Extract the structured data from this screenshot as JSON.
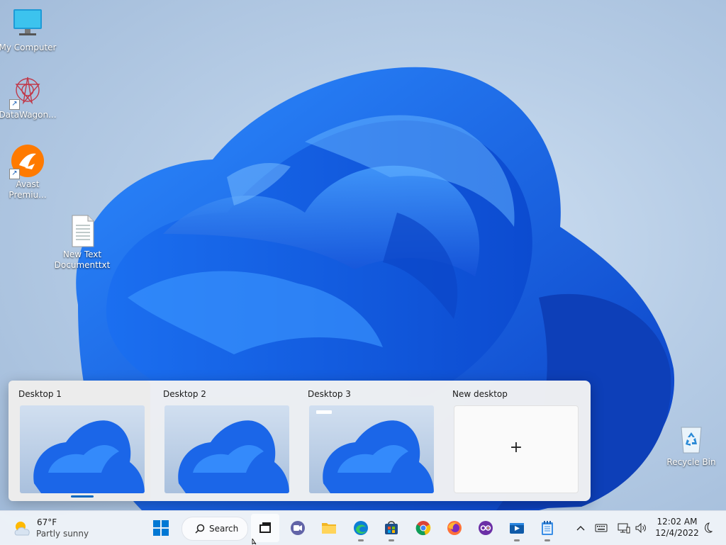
{
  "desktop": {
    "icons": [
      {
        "label": "My Computer",
        "icon": "monitor-icon"
      },
      {
        "label": "DataWagon...",
        "icon": "datawagon-icon"
      },
      {
        "label": "Avast Premiu...",
        "icon": "avast-icon"
      },
      {
        "label": "New Text Documenttxt",
        "icon": "text-file-icon"
      },
      {
        "label": "Recycle Bin",
        "icon": "recycle-bin-icon"
      }
    ]
  },
  "task_view": {
    "desktops": [
      {
        "label": "Desktop 1",
        "active": true
      },
      {
        "label": "Desktop 2",
        "active": false
      },
      {
        "label": "Desktop 3",
        "active": false
      }
    ],
    "new_desktop_label": "New desktop",
    "plus_symbol": "+"
  },
  "taskbar": {
    "weather": {
      "temp": "67°F",
      "condition": "Partly sunny"
    },
    "search_label": "Search",
    "apps": [
      {
        "name": "start",
        "icon": "windows-logo-icon"
      },
      {
        "name": "task-view",
        "icon": "task-view-icon"
      },
      {
        "name": "chat",
        "icon": "teams-chat-icon"
      },
      {
        "name": "file-explorer",
        "icon": "folder-icon"
      },
      {
        "name": "edge",
        "icon": "edge-icon"
      },
      {
        "name": "store",
        "icon": "store-icon"
      },
      {
        "name": "chrome",
        "icon": "chrome-icon"
      },
      {
        "name": "firefox",
        "icon": "firefox-icon"
      },
      {
        "name": "purple-app",
        "icon": "purple-app-icon"
      },
      {
        "name": "media-player",
        "icon": "media-player-icon"
      },
      {
        "name": "notepad",
        "icon": "notepad-icon"
      }
    ],
    "clock": {
      "time": "12:02 AM",
      "date": "12/4/2022"
    }
  },
  "colors": {
    "accent": "#0067c0",
    "wallpaper_bloom": "#1a63e0"
  }
}
